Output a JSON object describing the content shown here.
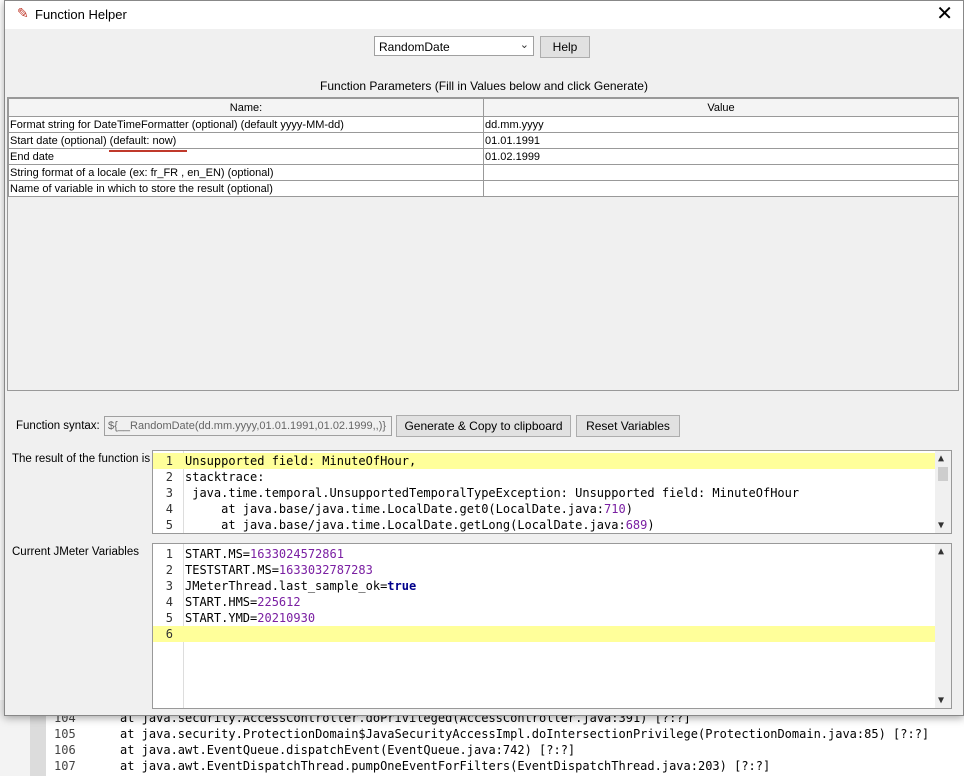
{
  "window": {
    "title": "Function Helper",
    "close_glyph": "✕",
    "icon": "feather-icon"
  },
  "function_select": {
    "value": "RandomDate",
    "help_label": "Help"
  },
  "caption": "Function Parameters (Fill in Values below and click Generate)",
  "params_table": {
    "headers": [
      "Name:",
      "Value"
    ],
    "rows": [
      {
        "name": "Format string for DateTimeFormatter (optional) (default yyyy-MM-dd)",
        "value": "dd.mm.yyyy"
      },
      {
        "name": "Start date (optional) (default: now)",
        "value": "01.01.1991"
      },
      {
        "name": "End date",
        "value": "01.02.1999"
      },
      {
        "name": "String format of a locale (ex: fr_FR , en_EN) (optional)",
        "value": ""
      },
      {
        "name": "Name of variable in which to store the result (optional)",
        "value": ""
      }
    ]
  },
  "syntax": {
    "label": "Function syntax:",
    "value": "${__RandomDate(dd.mm.yyyy,01.01.1991,01.02.1999,,)}",
    "generate_label": "Generate & Copy to clipboard",
    "reset_label": "Reset Variables"
  },
  "result": {
    "label": "The result of the function is",
    "lines": [
      {
        "n": "1",
        "text": "Unsupported field: MinuteOfHour,"
      },
      {
        "n": "2",
        "text": "stacktrace:"
      },
      {
        "n": "3",
        "text": " java.time.temporal.UnsupportedTemporalTypeException: Unsupported field: MinuteOfHour"
      },
      {
        "n": "4",
        "text": "     at java.base/java.time.LocalDate.get0(LocalDate.java:",
        "num": "710",
        "tail": ")"
      },
      {
        "n": "5",
        "text": "     at java.base/java.time.LocalDate.getLong(LocalDate.java:",
        "num": "689",
        "tail": ")"
      }
    ]
  },
  "variables": {
    "label": "Current JMeter Variables",
    "lines": [
      {
        "n": "1",
        "key": "START.MS=",
        "val": "1633024572861"
      },
      {
        "n": "2",
        "key": "TESTSTART.MS=",
        "val": "1633032787283"
      },
      {
        "n": "3",
        "key": "JMeterThread.last_sample_ok=",
        "val": "true"
      },
      {
        "n": "4",
        "key": "START.HMS=",
        "val": "225612"
      },
      {
        "n": "5",
        "key": "START.YMD=",
        "val": "20210930"
      },
      {
        "n": "6",
        "key": "",
        "val": ""
      }
    ]
  },
  "background_log": [
    {
      "n": "104",
      "text": "at java.security.AccessController.doPrivileged(AccessController.java:391) [?:?]"
    },
    {
      "n": "105",
      "text": "at java.security.ProtectionDomain$JavaSecurityAccessImpl.doIntersectionPrivilege(ProtectionDomain.java:85) [?:?]"
    },
    {
      "n": "106",
      "text": "at java.awt.EventQueue.dispatchEvent(EventQueue.java:742) [?:?]"
    },
    {
      "n": "107",
      "text": "at java.awt.EventDispatchThread.pumpOneEventForFilters(EventDispatchThread.java:203) [?:?]"
    }
  ]
}
